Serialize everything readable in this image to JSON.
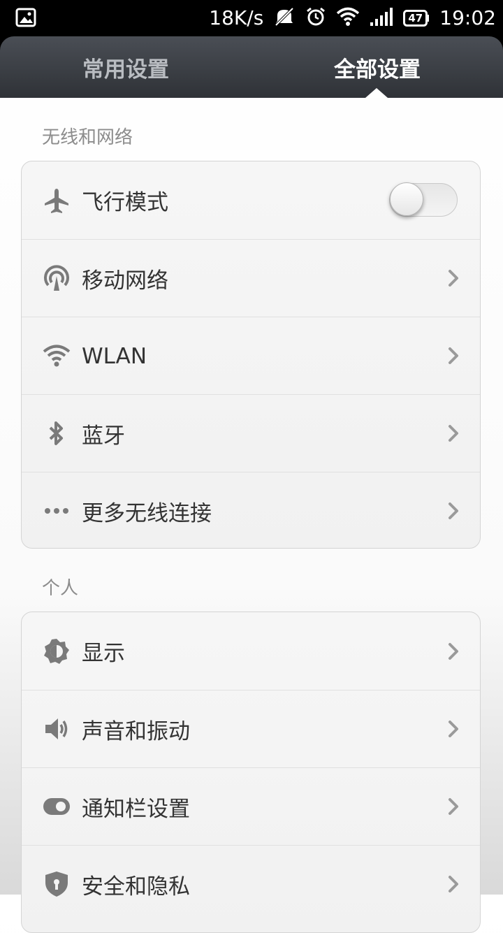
{
  "status_bar": {
    "network_speed": "18K/s",
    "battery": "47",
    "time": "19:02"
  },
  "tabs": [
    {
      "label": "常用设置",
      "active": false
    },
    {
      "label": "全部设置",
      "active": true
    }
  ],
  "sections": [
    {
      "title": "无线和网络",
      "items": [
        {
          "label": "飞行模式",
          "icon": "airplane-icon",
          "control": "toggle",
          "enabled": false
        },
        {
          "label": "移动网络",
          "icon": "mobile-network-icon",
          "control": "chevron"
        },
        {
          "label": "WLAN",
          "icon": "wifi-icon",
          "control": "chevron"
        },
        {
          "label": "蓝牙",
          "icon": "bluetooth-icon",
          "control": "chevron"
        },
        {
          "label": "更多无线连接",
          "icon": "more-dots-icon",
          "control": "chevron"
        }
      ]
    },
    {
      "title": "个人",
      "items": [
        {
          "label": "显示",
          "icon": "display-brightness-icon",
          "control": "chevron"
        },
        {
          "label": "声音和振动",
          "icon": "sound-icon",
          "control": "chevron"
        },
        {
          "label": "通知栏设置",
          "icon": "notification-toggle-icon",
          "control": "chevron"
        },
        {
          "label": "安全和隐私",
          "icon": "shield-icon",
          "control": "chevron"
        }
      ]
    }
  ],
  "colors": {
    "tab_active": "#ffffff",
    "tab_inactive": "#b9bcc1",
    "section_title": "#8c8c8c",
    "icon": "#7a7a7a",
    "chevron": "#9a9a9a"
  }
}
